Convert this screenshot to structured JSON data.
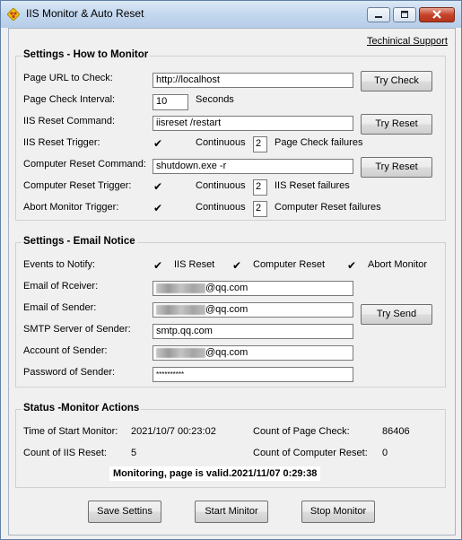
{
  "window": {
    "title": "IIS Monitor & Auto Reset",
    "icon": "app-diamond-icon"
  },
  "support_link": "Techinical Support",
  "monitor_settings": {
    "title": "Settings - How to Monitor",
    "page_url_label": "Page URL to Check:",
    "page_url_value": "http://localhost",
    "try_check_label": "Try Check",
    "interval_label": "Page Check Interval:",
    "interval_value": "10",
    "interval_unit": "Seconds",
    "iis_reset_cmd_label": "IIS Reset Command:",
    "iis_reset_cmd_value": "iisreset /restart",
    "try_reset_label": "Try Reset",
    "iis_reset_trigger_label": "IIS Reset Trigger:",
    "continuous_label": "Continuous",
    "iis_reset_trigger_count": "2",
    "iis_reset_trigger_suffix": "Page Check failures",
    "computer_reset_cmd_label": "Computer Reset Command:",
    "computer_reset_cmd_value": "shutdown.exe -r",
    "computer_reset_trigger_label": "Computer Reset Trigger:",
    "computer_reset_trigger_count": "2",
    "computer_reset_trigger_suffix": "IIS Reset failures",
    "abort_trigger_label": "Abort Monitor Trigger:",
    "abort_trigger_count": "2",
    "abort_trigger_suffix": "Computer Reset failures"
  },
  "email_settings": {
    "title": "Settings - Email Notice",
    "events_label": "Events to Notify:",
    "event_iis_reset": "IIS Reset",
    "event_computer_reset": "Computer Reset",
    "event_abort_monitor": "Abort Monitor",
    "receiver_label": "Email of Rceiver:",
    "receiver_domain": "@qq.com",
    "sender_label": "Email of Sender:",
    "sender_domain": "@qq.com",
    "try_send_label": "Try Send",
    "smtp_label": "SMTP Server of Sender:",
    "smtp_value": "smtp.qq.com",
    "account_label": "Account of Sender:",
    "account_domain": "@qq.com",
    "password_label": "Password of Sender:",
    "password_value": "**********"
  },
  "status": {
    "title": "Status -Monitor Actions",
    "start_time_label": "Time of Start Monitor:",
    "start_time_value": "2021/10/7 00:23:02",
    "page_check_count_label": "Count of Page Check:",
    "page_check_count_value": "86406",
    "iis_reset_count_label": "Count of IIS Reset:",
    "iis_reset_count_value": "5",
    "computer_reset_count_label": "Count of Computer Reset:",
    "computer_reset_count_value": "0",
    "message": "Monitoring, page is valid.2021/11/07  0:29:38"
  },
  "footer": {
    "save_label": "Save Settins",
    "start_label": "Start Minitor",
    "stop_label": "Stop Monitor"
  }
}
